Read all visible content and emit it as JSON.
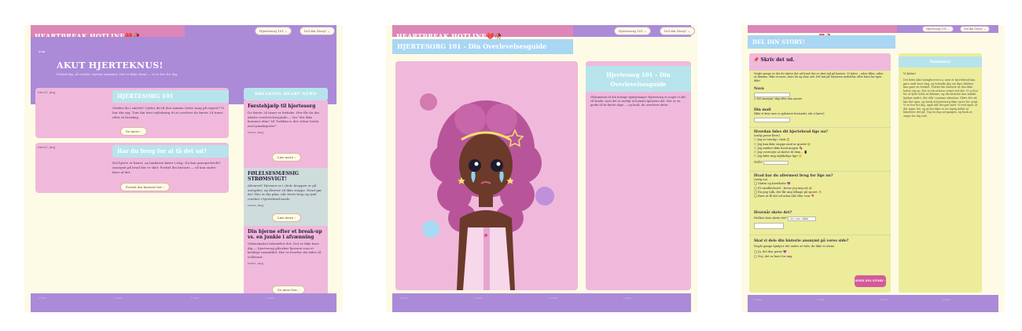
{
  "colors": {
    "lavender": "#ab8ad8",
    "pink": "#f0b9db",
    "hot_pink": "#dd86b8",
    "light_blue": "#b7e4ec",
    "sky_blue": "#a9d6f2",
    "cream": "#fdfbe6",
    "pale_yellow": "#ecec9b"
  },
  "brand": "HEARTBREAK HOTLINE💔🥀",
  "nav": {
    "first": "Hjertesorg 101 ⌄",
    "second": "Del din Story! ⌄"
  },
  "page1": {
    "hero_img_alt": "icon",
    "hero_title": "AKUT HJERTEKNUS!",
    "hero_subtitle": "Forlad dig, så vender styrten sammen! Det er ikke slemt — vi er her for dig.",
    "card1": {
      "img_alt": "Intro1_img",
      "title": "HJERTESORG 101",
      "text": "Grøder du i smerte? Lytter du til den samme triste sang på repeat? Vi har din ryg. Tom din trist vejledning til at overleve de første 24 timer efter et breakup.",
      "button": "Se mere ›"
    },
    "card2": {
      "img_alt": "Intro2_img",
      "title": "Har du brug for at få det ud?",
      "text": "Del hjerte er knust, og tankerne kører i ring. Du kan genoprette/fel anonymt på hvad der er sket. Fortæl din historie — så kan andre lære af det.",
      "button": "Fortæl din historie her ›"
    },
    "sidebar": {
      "title": "BREAKING HEART NEWS",
      "items": [
        {
          "title": "Førstehjælp til hjertesorg",
          "text": "De første 24 timer er kritiske. Her får du din akutte overlevelsesguide — fra \"det ikke kommer dem\" til \"hvilken is der virker bedst mod pandøgerier\".",
          "img_alt": "news_img",
          "button": "Læs mere ›"
        },
        {
          "title": "FØLELSESMÆSSIG STRØMSVIGT!",
          "text": "Advarsel! Hjernen er i chok, kroppen er på autopilot, og tårerne vil ikke stoppe. Hvad gør du? Her er din plan, når livets krop og sjæl crasher i hjertebrud-mode.",
          "img_alt": "news_img",
          "button": "Læs mere ›"
        },
        {
          "title": "Din hjerne efter et break-up vs. en junkie i afvænning",
          "text": "Videnskaben bekræfter det: Det er ikke bare dig — hjertesorg påvirker hjernen som et kraftigt rusmiddel. Her er hvorfor det føles så voldsomt.",
          "img_alt": "news_img",
          "button": "Se mere her ›"
        }
      ]
    },
    "footer": [
      "Lorem",
      "Lorem",
      "Lorem",
      "Lorem"
    ]
  },
  "page2": {
    "title": "HJERTESORG 101 - Din Overlevelsesguide",
    "side_title": "Hjertesorg 101 – Din Overlevelsesguide",
    "side_text": "Velkommen til din hurtige hjælpslange! Hjertesorg er noget vi alle vil kende, men det er muligt at komme igennem det. Her er en guide til de første dage — og husk, du overlever dette.",
    "footer": [
      "Lorem",
      "Lorem",
      "Lorem",
      "Lorem"
    ]
  },
  "page3": {
    "title": "DEL DIN STORY!",
    "form": {
      "header": "📌 Skriv det ud.",
      "intro": "Nogle gange er det du skrive det ud hvad der er sket ind på kanten. Vi lytter – uden filter, uden at dømme. Ikke et navn, bare du og dine ord. Del ind på historien nedenfor, eller bare lav igen ikke!",
      "name_label": "Navn",
      "name_hint": "☑ Del anonymt, skip efter min navnet",
      "email_label": "Din mail",
      "email_hint": "(Ikke et krav, men vi opdaterer bestandet, når vi kører)",
      "q1_label": "Hvordan føles dit hjertebrud lige nu?",
      "q1_hint": "(vælg gerne flere)",
      "q1_options": [
        "Jeg er totalig i chok 😱",
        "Jeg kan ikke stoppe med at græde 😢",
        "Jeg mæker ikke hvad magen 🍫",
        "Jeg overvejer at skrive til dem... 📱",
        "Jeg føler mig ulykkelige lige 🙁"
      ],
      "q1_other": "Andet",
      "q2_label": "Hvad har du allermest brug for lige nu?",
      "q2_hint": "(vælg en)",
      "q2_options": [
        "Støtte og forståelse 💜",
        "Et sandhedsord – bevar jeg mig ud 😅",
        "En pep talk, der får mig tilbage på sporet 🔥",
        "Bare at få det ud uden råd eller svar 🎈"
      ],
      "date_label": "Hvornår skete det?",
      "date_prefix": "Hvilket dato skete det?",
      "date_value": "dd / mm / åååå",
      "publish_label": "Skal vi dele din historie anonymt på vores side?",
      "publish_hint": "Nogle gange hjælper det andre at vide, de ikke er alene.",
      "publish_options": [
        "Ja, del den gerne 💜",
        "Nej, det er bare for mig"
      ],
      "send_button": "SEND DIN STORY ›"
    },
    "summary": {
      "title": "Summary",
      "label": "Vi lytter!",
      "text": "Det føles ikke kompliceret nu, men et hjertebrud kan gøre ondt hver dag, og fortælle dig om dine følelser kan gøre en forskel. Fortæl din historie så den ikke hober sig op. Det er ok at have svært ved det. Vi er her for at lytte uden at dømme, og din historie kan måske hjælpe andre, der står i samme situation. Skriv det ud, læs det igen, og husk at hjertesorg ikke varer for evigt. Vi er her for dig, også når det gør ondt. Vi ved også, at det tager tid, og at der ikke er en rigtig måde at håndtere det på. Tag en dag ad gangen, og husk at sørge for dig selv."
    },
    "footer": [
      "Lorem",
      "Lorem",
      "Lorem",
      "Lorem"
    ]
  }
}
